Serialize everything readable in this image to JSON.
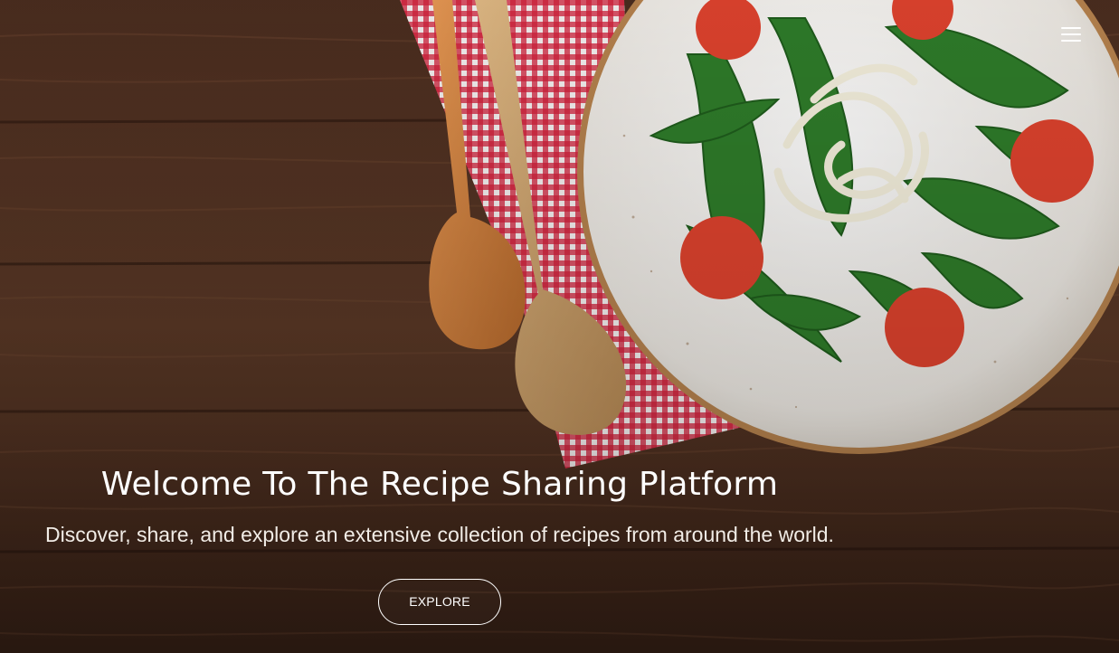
{
  "header": {
    "menu_icon": "hamburger-menu-icon"
  },
  "hero": {
    "title": "Welcome To The Recipe Sharing Platform",
    "subtitle": "Discover, share, and explore an extensive collection of recipes from around the world.",
    "cta_label": "EXPLORE"
  },
  "colors": {
    "text": "#ffffff",
    "wood": "#4a2d1e",
    "napkin_red": "#c8102e",
    "plate": "#f4f2ee"
  }
}
